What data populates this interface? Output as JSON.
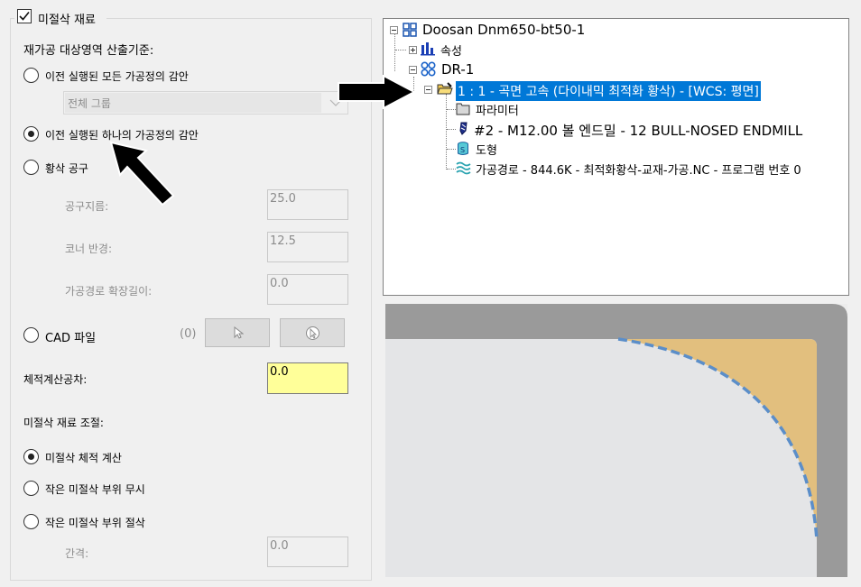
{
  "left_panel": {
    "rest_material_checkbox": {
      "label": "미절삭 재료",
      "checked": true
    },
    "criteria_heading": "재가공 대상영역 산출기준:",
    "option_all_prev": "이전 실행된 모든 가공정의 감안",
    "group_combo_value": "전체 그룹",
    "option_one_prev": "이전 실행된 하나의 가공정의 감안",
    "option_rough_tool": "황삭 공구",
    "tool_diameter": {
      "label": "공구지름:",
      "value": "25.0"
    },
    "corner_radius": {
      "label": "코너 반경:",
      "value": "12.5"
    },
    "toolpath_extension": {
      "label": "가공경로 확장길이:",
      "value": "0.0"
    },
    "option_cad_file": "CAD 파일",
    "cad_count": "(0)",
    "volume_tolerance": {
      "label": "체적계산공차:",
      "value": "0.0"
    },
    "adjust_heading": "미절삭 재료 조절:",
    "adjust_compute": "미절삭 체적 계산",
    "adjust_ignore": "작은 미절삭 부위 무시",
    "adjust_cut": "작은 미절삭 부위 절삭",
    "spacing": {
      "label": "간격:",
      "value": "0.0"
    }
  },
  "tree": {
    "machine": "Doosan Dnm650-bt50-1",
    "properties": "속성",
    "group": "DR-1",
    "operation": "1 : 1 - 곡면 고속 (다이내믹 최적화 황삭) - [WCS: 평면]",
    "parameters": "파라미터",
    "tool": "#2 - M12.00 볼 엔드밀 - 12 BULL-NOSED ENDMILL",
    "geometry": "도형",
    "toolpath": "가공경로 - 844.6K - 최적화황삭-교재-가공.NC - 프로그램 번호 0"
  },
  "colors": {
    "selection": "#0078d7",
    "highlight_field": "#ffff99",
    "rest_material": "#e2bf7e",
    "toolpath_dash": "#5b8ec9",
    "stock": "#9a9a9a"
  }
}
